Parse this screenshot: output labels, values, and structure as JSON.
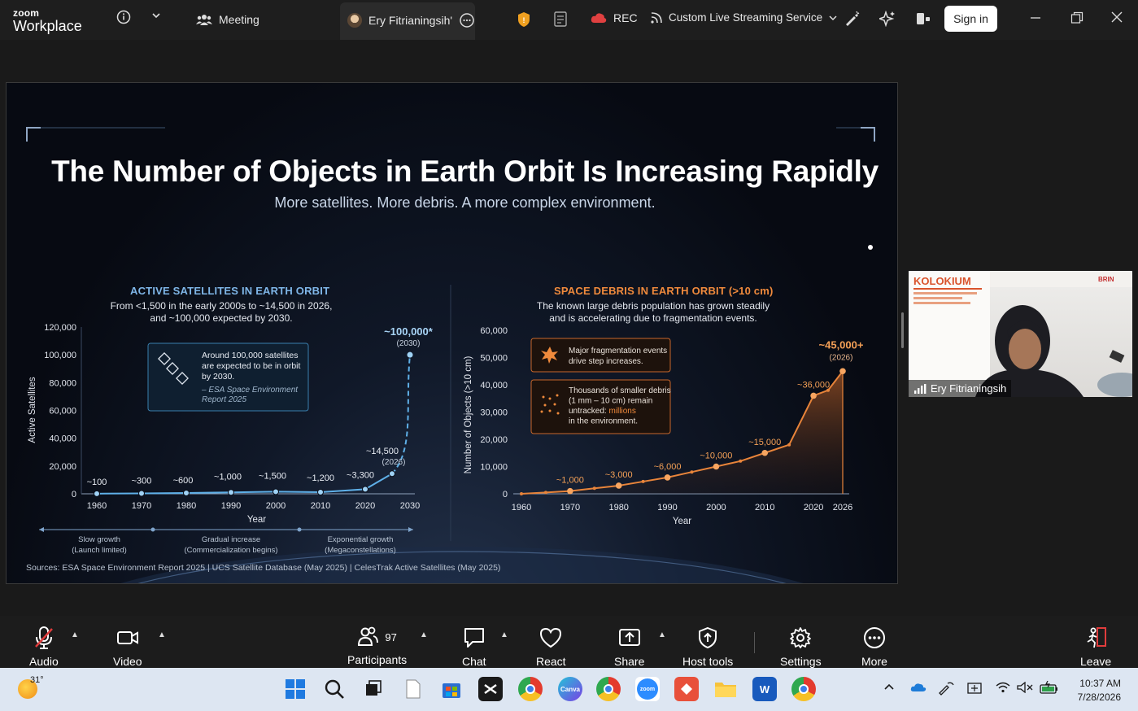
{
  "app": {
    "brand_top": "zoom",
    "brand_bottom": "Workplace"
  },
  "topbar": {
    "meeting_label": "Meeting",
    "speaker_tab": "Ery Fitrianingsih'",
    "rec_label": "REC",
    "streaming_label": "Custom Live Streaming Service",
    "sign_in": "Sign in"
  },
  "slide": {
    "title": "The Number of Objects in Earth Orbit Is Increasing Rapidly",
    "subtitle": "More satellites. More debris. A more complex environment.",
    "sources": "Sources: ESA Space Environment Report 2025 | UCS Satellite Database (May 2025) | CelesTrak Active Satellites (May 2025)"
  },
  "chart_data": [
    {
      "type": "line",
      "title": "ACTIVE SATELLITES IN EARTH ORBIT",
      "subtitle": "From <1,500 in the early 2000s to ~14,500 in 2026,\nand ~100,000 expected by 2030.",
      "xlabel": "Year",
      "ylabel": "Active Satellites",
      "xlim": [
        1960,
        2030
      ],
      "ylim": [
        0,
        120000
      ],
      "x_ticks": [
        "1960",
        "1970",
        "1980",
        "1990",
        "2000",
        "2010",
        "2020",
        "2030"
      ],
      "y_ticks": [
        "0",
        "20,000",
        "40,000",
        "60,000",
        "80,000",
        "100,000",
        "120,000"
      ],
      "points": [
        {
          "x": 1960,
          "y": 100,
          "label": "~100"
        },
        {
          "x": 1970,
          "y": 300,
          "label": "~300"
        },
        {
          "x": 1980,
          "y": 600,
          "label": "~600"
        },
        {
          "x": 1990,
          "y": 1000,
          "label": "~1,000"
        },
        {
          "x": 2000,
          "y": 1500,
          "label": "~1,500"
        },
        {
          "x": 2010,
          "y": 1200,
          "label": "~1,200"
        },
        {
          "x": 2020,
          "y": 3300,
          "label": "~3,300"
        },
        {
          "x": 2026,
          "y": 14500,
          "label": "~14,500",
          "sublabel": "(2026)"
        }
      ],
      "projection": {
        "x": 2030,
        "y": 100000,
        "label": "~100,000*",
        "sublabel": "(2030)"
      },
      "callout": {
        "text": [
          "Around 100,000 satellites",
          "are expected to be in orbit",
          "by 2030."
        ],
        "source": [
          "– ESA Space Environment",
          "Report 2025"
        ]
      },
      "phases": [
        {
          "line1": "Slow growth",
          "line2": "(Launch limited)"
        },
        {
          "line1": "Gradual increase",
          "line2": "(Commercialization begins)"
        },
        {
          "line1": "Exponential growth",
          "line2": "(Megaconstellations)"
        }
      ],
      "color": "#5fb0e8"
    },
    {
      "type": "area",
      "title": "SPACE DEBRIS IN EARTH ORBIT (>10 cm)",
      "subtitle": "The known large debris population has grown steadily\nand is accelerating due to fragmentation events.",
      "xlabel": "Year",
      "ylabel": "Number of Objects (>10 cm)",
      "xlim": [
        1960,
        2026
      ],
      "ylim": [
        0,
        60000
      ],
      "x_ticks": [
        "1960",
        "1970",
        "1980",
        "1990",
        "2000",
        "2010",
        "2020",
        "2026"
      ],
      "y_ticks": [
        "0",
        "10,000",
        "20,000",
        "30,000",
        "40,000",
        "50,000",
        "60,000"
      ],
      "points": [
        {
          "x": 1960,
          "y": 0
        },
        {
          "x": 1965,
          "y": 500
        },
        {
          "x": 1970,
          "y": 1000,
          "label": "~1,000"
        },
        {
          "x": 1975,
          "y": 2000
        },
        {
          "x": 1980,
          "y": 3000,
          "label": "~3,000"
        },
        {
          "x": 1985,
          "y": 4500
        },
        {
          "x": 1990,
          "y": 6000,
          "label": "~6,000"
        },
        {
          "x": 1995,
          "y": 8000
        },
        {
          "x": 2000,
          "y": 10000,
          "label": "~10,000"
        },
        {
          "x": 2005,
          "y": 12000
        },
        {
          "x": 2010,
          "y": 15000,
          "label": "~15,000"
        },
        {
          "x": 2015,
          "y": 18000
        },
        {
          "x": 2020,
          "y": 36000,
          "label": "~36,000"
        },
        {
          "x": 2023,
          "y": 38000
        },
        {
          "x": 2026,
          "y": 45000,
          "label": "~45,000+",
          "sublabel": "(2026)"
        }
      ],
      "callouts": [
        {
          "text": [
            "Major fragmentation events",
            "drive step increases."
          ]
        },
        {
          "text_before": [
            "Thousands of smaller debris",
            "(1 mm – 10 cm) remain",
            "untracked: "
          ],
          "highlight": "millions",
          "text_after": "in the environment."
        }
      ],
      "color": "#e8843a"
    }
  ],
  "video": {
    "name": "Ery Fitrianingsih",
    "slide_title": "KOLOKIUM",
    "org": "BRIN"
  },
  "toolbar": {
    "audio": "Audio",
    "video": "Video",
    "participants": "Participants",
    "participant_count": "97",
    "chat": "Chat",
    "react": "React",
    "share": "Share",
    "host_tools": "Host tools",
    "settings": "Settings",
    "more": "More",
    "leave": "Leave"
  },
  "taskbar": {
    "weather": "31°",
    "time": "10:37 AM",
    "date": "7/28/2026"
  }
}
